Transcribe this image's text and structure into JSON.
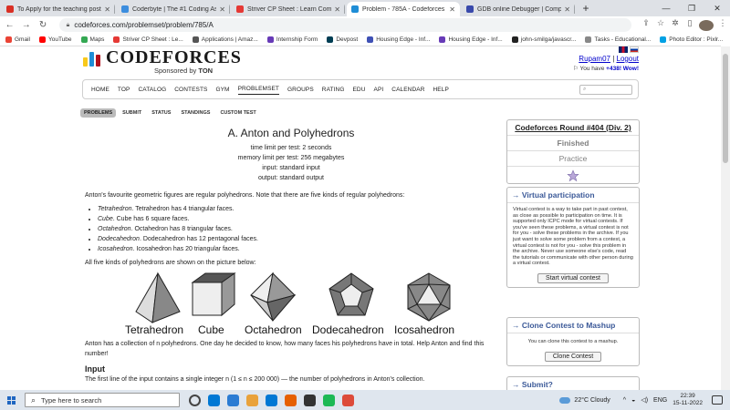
{
  "browser": {
    "tabs": [
      {
        "title": "To Apply for the teaching post - ",
        "color": "#d93025",
        "active": false
      },
      {
        "title": "Coderbyte | The #1 Coding Asse",
        "color": "#3c8dde",
        "active": false
      },
      {
        "title": "Striver CP Sheet : Learn Competi",
        "color": "#e53935",
        "active": false
      },
      {
        "title": "Problem - 785A - Codeforces",
        "color": "#1f8dd6",
        "active": true
      },
      {
        "title": "GDB online Debugger | Compiler",
        "color": "#3949ab",
        "active": false
      }
    ],
    "new_tab_label": "+",
    "url": "codeforces.com/problemset/problem/785/A",
    "bookmarks": [
      {
        "label": "Gmail",
        "color": "#ea4335"
      },
      {
        "label": "YouTube",
        "color": "#ff0000"
      },
      {
        "label": "Maps",
        "color": "#34a853"
      },
      {
        "label": "Striver CP Sheet : Le...",
        "color": "#e53935"
      },
      {
        "label": "Applications | Amaz...",
        "color": "#555555"
      },
      {
        "label": "Internship Form",
        "color": "#673ab7"
      },
      {
        "label": "Devpost",
        "color": "#003e54"
      },
      {
        "label": "Housing Edge - Inf...",
        "color": "#3f51b5"
      },
      {
        "label": "Housing Edge - Inf...",
        "color": "#673ab7"
      },
      {
        "label": "john-smilga/javascr...",
        "color": "#222222"
      },
      {
        "label": "Tasks - Educational...",
        "color": "#888888"
      },
      {
        "label": "Photo Editor : Pixlr...",
        "color": "#00a1e4"
      }
    ]
  },
  "header": {
    "logo_text": "CODEFORCES",
    "sponsor_text": "Sponsored by",
    "sponsor_name": "TON",
    "user_name": "Rupam07",
    "separator": "|",
    "logout_label": "Logout",
    "you_have_text": "You have",
    "wow_text": "+438! Wow!",
    "bar_colors": [
      "#f8c91c",
      "#1f8dd6",
      "#b3101c"
    ]
  },
  "menu": {
    "items": [
      "HOME",
      "TOP",
      "CATALOG",
      "CONTESTS",
      "GYM",
      "PROBLEMSET",
      "GROUPS",
      "RATING",
      "EDU",
      "API",
      "CALENDAR",
      "HELP"
    ],
    "active": "PROBLEMSET"
  },
  "subtabs": [
    "PROBLEMS",
    "SUBMIT",
    "STATUS",
    "STANDINGS",
    "CUSTOM TEST"
  ],
  "problem": {
    "title": "A. Anton and Polyhedrons",
    "time_limit": "time limit per test: 2 seconds",
    "memory_limit": "memory limit per test: 256 megabytes",
    "input": "input: standard input",
    "output": "output: standard output",
    "intro": "Anton's favourite geometric figures are regular polyhedrons. Note that there are five kinds of regular polyhedrons:",
    "list": [
      {
        "name": "Tetrahedron",
        "text": ". Tetrahedron has 4 triangular faces."
      },
      {
        "name": "Cube",
        "text": ". Cube has 6 square faces."
      },
      {
        "name": "Octahedron",
        "text": ". Octahedron has 8 triangular faces."
      },
      {
        "name": "Dodecahedron",
        "text": ". Dodecahedron has 12 pentagonal faces."
      },
      {
        "name": "Icosahedron",
        "text": ". Icosahedron has 20 triangular faces."
      }
    ],
    "picture_intro": "All five kinds of polyhedrons are shown on the picture below:",
    "shape_labels": [
      "Tetrahedron",
      "Cube",
      "Octahedron",
      "Dodecahedron",
      "Icosahedron"
    ],
    "collection_text": "Anton has a collection of n polyhedrons. One day he decided to know, how many faces his polyhedrons have in total. Help Anton and find this number!",
    "input_heading": "Input",
    "input_text": "The first line of the input contains a single integer n (1 ≤ n ≤ 200 000) — the number of polyhedrons in Anton's collection."
  },
  "sidebar": {
    "round_title": "Codeforces Round #404 (Div. 2)",
    "round_status": "Finished",
    "round_practice": "Practice",
    "virtual_head": "→ Virtual participation",
    "virtual_text": "Virtual contest is a way to take part in past contest, as close as possible to participation on time. It is supported only ICPC mode for virtual contests. If you've seen these problems, a virtual contest is not for you - solve these problems in the archive. If you just want to solve some problem from a contest, a virtual contest is not for you - solve this problem in the archive. Never use someone else's code, read the tutorials or communicate with other person during a virtual contest.",
    "virtual_button": "Start virtual contest",
    "clone_head": "→ Clone Contest to Mashup",
    "clone_text": "You can clone this contest to a mashup.",
    "clone_button": "Clone Contest",
    "submit_head": "→ Submit?"
  },
  "taskbar": {
    "search_placeholder": "Type here to search",
    "weather": "22°C  Cloudy",
    "lang": "ENG",
    "time": "22:39",
    "date": "15-11-2022",
    "app_colors": [
      "#444444",
      "#0078d4",
      "#2b7cd3",
      "#e9a23b",
      "#0078d4",
      "#e66000",
      "#333333",
      "#1db954",
      "#dd4b39"
    ]
  }
}
